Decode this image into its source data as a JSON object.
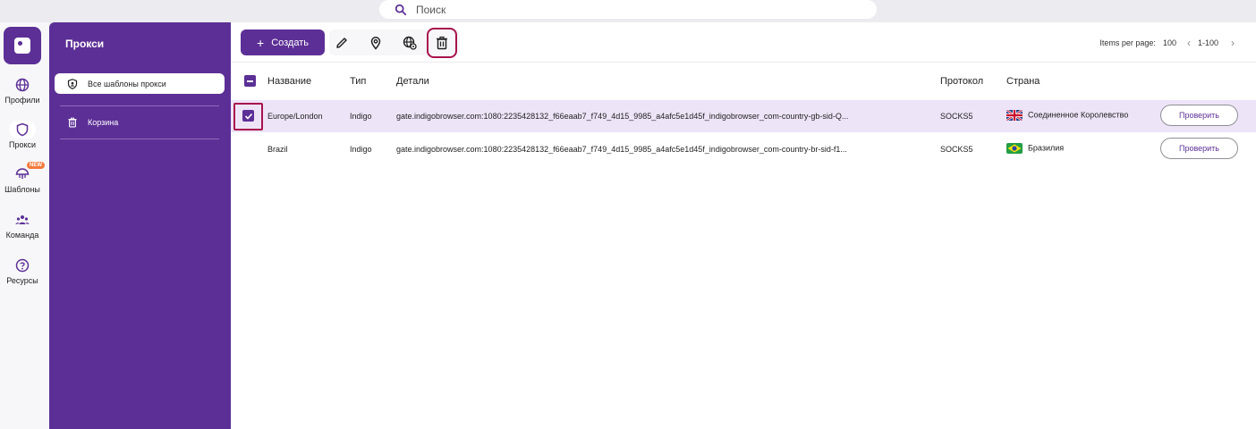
{
  "search": {
    "placeholder": "Поиск"
  },
  "rail": {
    "items": [
      {
        "label": "Профили",
        "icon": "globe-icon"
      },
      {
        "label": "Прокси",
        "icon": "shield-icon",
        "active": true
      },
      {
        "label": "Шаблоны",
        "icon": "umbrella-icon",
        "badge": "NEW"
      },
      {
        "label": "Команда",
        "icon": "team-icon"
      },
      {
        "label": "Ресурсы",
        "icon": "help-icon"
      }
    ]
  },
  "panel": {
    "title": "Прокси",
    "items": [
      {
        "label": "Все шаблоны прокси",
        "icon": "shield-icon",
        "active": true
      },
      {
        "label": "Корзина",
        "icon": "trash-icon"
      }
    ]
  },
  "toolbar": {
    "create_label": "Создать",
    "tools": [
      "edit-icon",
      "location-icon",
      "globe-settings-icon",
      "trash-icon"
    ],
    "per_page_label": "Items per page:",
    "per_page_value": "100",
    "range": "1-100"
  },
  "table": {
    "columns": [
      "Название",
      "Тип",
      "Детали",
      "Протокол",
      "Страна"
    ],
    "rows": [
      {
        "name": "Europe/London",
        "type": "Indigo",
        "details": "gate.indigobrowser.com:1080:2235428132_f66eaab7_f749_4d15_9985_a4afc5e1d45f_indigobrowser_com-country-gb-sid-Q...",
        "protocol": "SOCKS5",
        "country": "Соединенное Королевство",
        "action": "Проверить",
        "selected": true
      },
      {
        "name": "Brazil",
        "type": "Indigo",
        "details": "gate.indigobrowser.com:1080:2235428132_f66eaab7_f749_4d15_9985_a4afc5e1d45f_indigobrowser_com-country-br-sid-f1...",
        "protocol": "SOCKS5",
        "country": "Бразилия",
        "action": "Проверить",
        "selected": false
      }
    ]
  },
  "colors": {
    "accent": "#5c2f96",
    "highlight": "#a8124c",
    "badge": "#f47a3c",
    "selected_row": "#eee4f8"
  }
}
